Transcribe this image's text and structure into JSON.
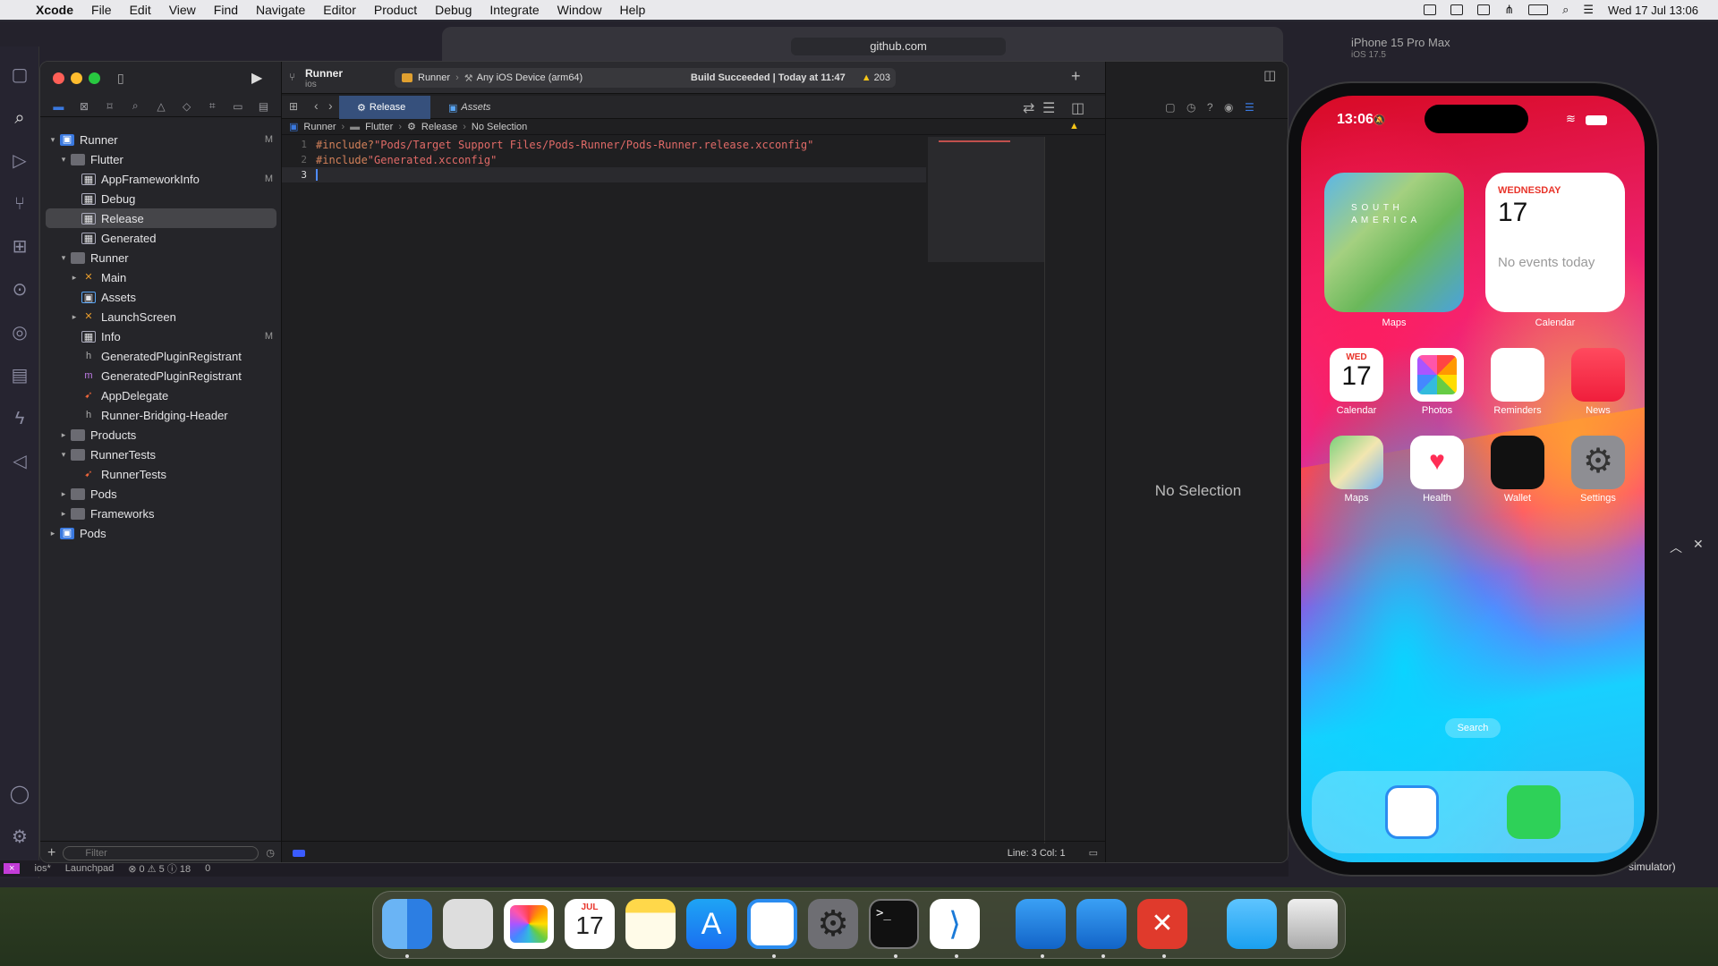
{
  "menubar": {
    "app": "Xcode",
    "items": [
      "File",
      "Edit",
      "View",
      "Find",
      "Navigate",
      "Editor",
      "Product",
      "Debug",
      "Integrate",
      "Window",
      "Help"
    ],
    "datetime": "Wed 17 Jul  13:06"
  },
  "browser": {
    "url": "github.com"
  },
  "sim_header": {
    "device": "iPhone 15 Pro Max",
    "os": "iOS 17.5"
  },
  "xcode": {
    "project_name": "Runner",
    "project_sub": "ios",
    "scheme": "Runner",
    "destination": "Any iOS Device (arm64)",
    "build_status": "Build Succeeded | Today at 11:47",
    "warnings": "203",
    "tabs": [
      "Release",
      "Assets"
    ],
    "breadcrumb": [
      "Runner",
      "Flutter",
      "Release",
      "No Selection"
    ],
    "tree": [
      {
        "label": "Runner",
        "level": 0,
        "icon": "proj",
        "disc": "open",
        "badge": "M"
      },
      {
        "label": "Flutter",
        "level": 1,
        "icon": "folder",
        "disc": "open",
        "badge": ""
      },
      {
        "label": "AppFrameworkInfo",
        "level": 2,
        "icon": "cfg",
        "disc": "",
        "badge": "M"
      },
      {
        "label": "Debug",
        "level": 2,
        "icon": "cfg",
        "disc": "",
        "badge": ""
      },
      {
        "label": "Release",
        "level": 2,
        "icon": "cfg",
        "disc": "",
        "badge": "",
        "selected": true
      },
      {
        "label": "Generated",
        "level": 2,
        "icon": "cfg",
        "disc": "",
        "badge": ""
      },
      {
        "label": "Runner",
        "level": 1,
        "icon": "folder",
        "disc": "open",
        "badge": ""
      },
      {
        "label": "Main",
        "level": 2,
        "icon": "sb",
        "disc": "closed",
        "badge": ""
      },
      {
        "label": "Assets",
        "level": 2,
        "icon": "asset",
        "disc": "",
        "badge": ""
      },
      {
        "label": "LaunchScreen",
        "level": 2,
        "icon": "sb",
        "disc": "closed",
        "badge": ""
      },
      {
        "label": "Info",
        "level": 2,
        "icon": "cfg",
        "disc": "",
        "badge": "M"
      },
      {
        "label": "GeneratedPluginRegistrant",
        "level": 2,
        "icon": "h",
        "disc": "",
        "badge": ""
      },
      {
        "label": "GeneratedPluginRegistrant",
        "level": 2,
        "icon": "m",
        "disc": "",
        "badge": ""
      },
      {
        "label": "AppDelegate",
        "level": 2,
        "icon": "sw",
        "disc": "",
        "badge": ""
      },
      {
        "label": "Runner-Bridging-Header",
        "level": 2,
        "icon": "h",
        "disc": "",
        "badge": ""
      },
      {
        "label": "Products",
        "level": 1,
        "icon": "folder",
        "disc": "closed",
        "badge": ""
      },
      {
        "label": "RunnerTests",
        "level": 1,
        "icon": "folder",
        "disc": "open",
        "badge": ""
      },
      {
        "label": "RunnerTests",
        "level": 2,
        "icon": "sw",
        "disc": "",
        "badge": ""
      },
      {
        "label": "Pods",
        "level": 1,
        "icon": "folder",
        "disc": "closed",
        "badge": ""
      },
      {
        "label": "Frameworks",
        "level": 1,
        "icon": "folder",
        "disc": "closed",
        "badge": ""
      },
      {
        "label": "Pods",
        "level": 0,
        "icon": "proj",
        "disc": "closed",
        "badge": ""
      }
    ],
    "code": [
      {
        "n": "1",
        "pre": "#include?",
        "str": " \"Pods/Target Support Files/Pods-Runner/Pods-Runner.release.xcconfig\""
      },
      {
        "n": "2",
        "pre": "#include",
        "str": " \"Generated.xcconfig\""
      },
      {
        "n": "3",
        "pre": "",
        "str": ""
      }
    ],
    "filter_placeholder": "Filter",
    "status": "Line: 3  Col: 1",
    "inspector_empty": "No Selection"
  },
  "vscode_status": {
    "branch": "ios*",
    "launchpad": "Launchpad",
    "counts": "⊗ 0 ⚠ 5 ⓘ 18",
    "ports": "0",
    "simulator": "simulator)"
  },
  "phone": {
    "time": "13:06",
    "widget_maps_label": "Maps",
    "map_text_1": "S O U T H",
    "map_text_2": "A M E R I C A",
    "widget_cal_day": "WEDNESDAY",
    "widget_cal_date": "17",
    "widget_cal_events": "No events today",
    "widget_cal_label": "Calendar",
    "apps_row1": [
      "Calendar",
      "Photos",
      "Reminders",
      "News"
    ],
    "apps_row2": [
      "Maps",
      "Health",
      "Wallet",
      "Settings"
    ],
    "cal_icon_day": "WED",
    "cal_icon_date": "17",
    "search": "Search"
  },
  "dock": {
    "cal_month": "JUL",
    "cal_date": "17"
  },
  "colors": {
    "accent": "#3a79e0",
    "selection": "#454549",
    "warning": "#f5c518"
  }
}
